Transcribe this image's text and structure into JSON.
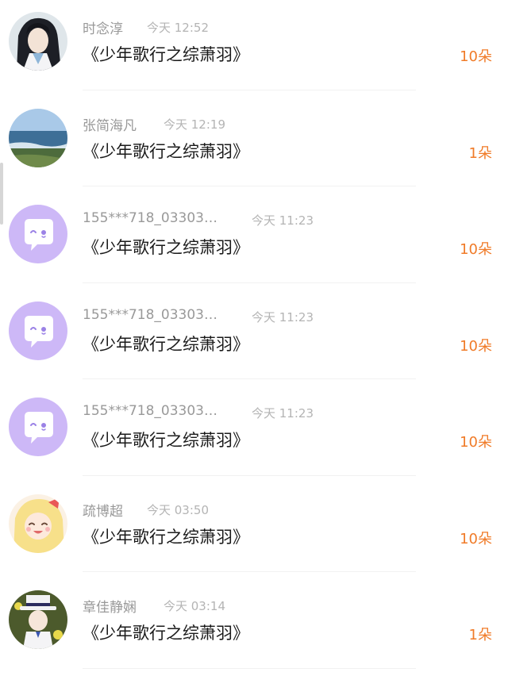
{
  "records": [
    {
      "name": "时念淳",
      "time": "今天 12:52",
      "title": "《少年歌行之综萧羽》",
      "count": "10朵",
      "avatar": "anime-character-avatar"
    },
    {
      "name": "张简海凡",
      "time": "今天 12:19",
      "title": "《少年歌行之综萧羽》",
      "count": "1朵",
      "avatar": "seaside-photo-avatar"
    },
    {
      "name": "155***718_03303…",
      "time": "今天 11:23",
      "title": "《少年歌行之综萧羽》",
      "count": "10朵",
      "avatar": "default-chat-bubble-avatar"
    },
    {
      "name": "155***718_03303…",
      "time": "今天 11:23",
      "title": "《少年歌行之综萧羽》",
      "count": "10朵",
      "avatar": "default-chat-bubble-avatar"
    },
    {
      "name": "155***718_03303…",
      "time": "今天 11:23",
      "title": "《少年歌行之综萧羽》",
      "count": "10朵",
      "avatar": "default-chat-bubble-avatar"
    },
    {
      "name": "疏博超",
      "time": "今天 03:50",
      "title": "《少年歌行之综萧羽》",
      "count": "10朵",
      "avatar": "anime-girl-avatar"
    },
    {
      "name": "章佳静娴",
      "time": "今天 03:14",
      "title": "《少年歌行之综萧羽》",
      "count": "1朵",
      "avatar": "anime-magician-avatar"
    }
  ],
  "colors": {
    "count": "#f07b28",
    "name": "#999999",
    "time": "#b4b4b4",
    "title": "#1a1a1a",
    "default_avatar_bg": "#cdb8f7"
  }
}
